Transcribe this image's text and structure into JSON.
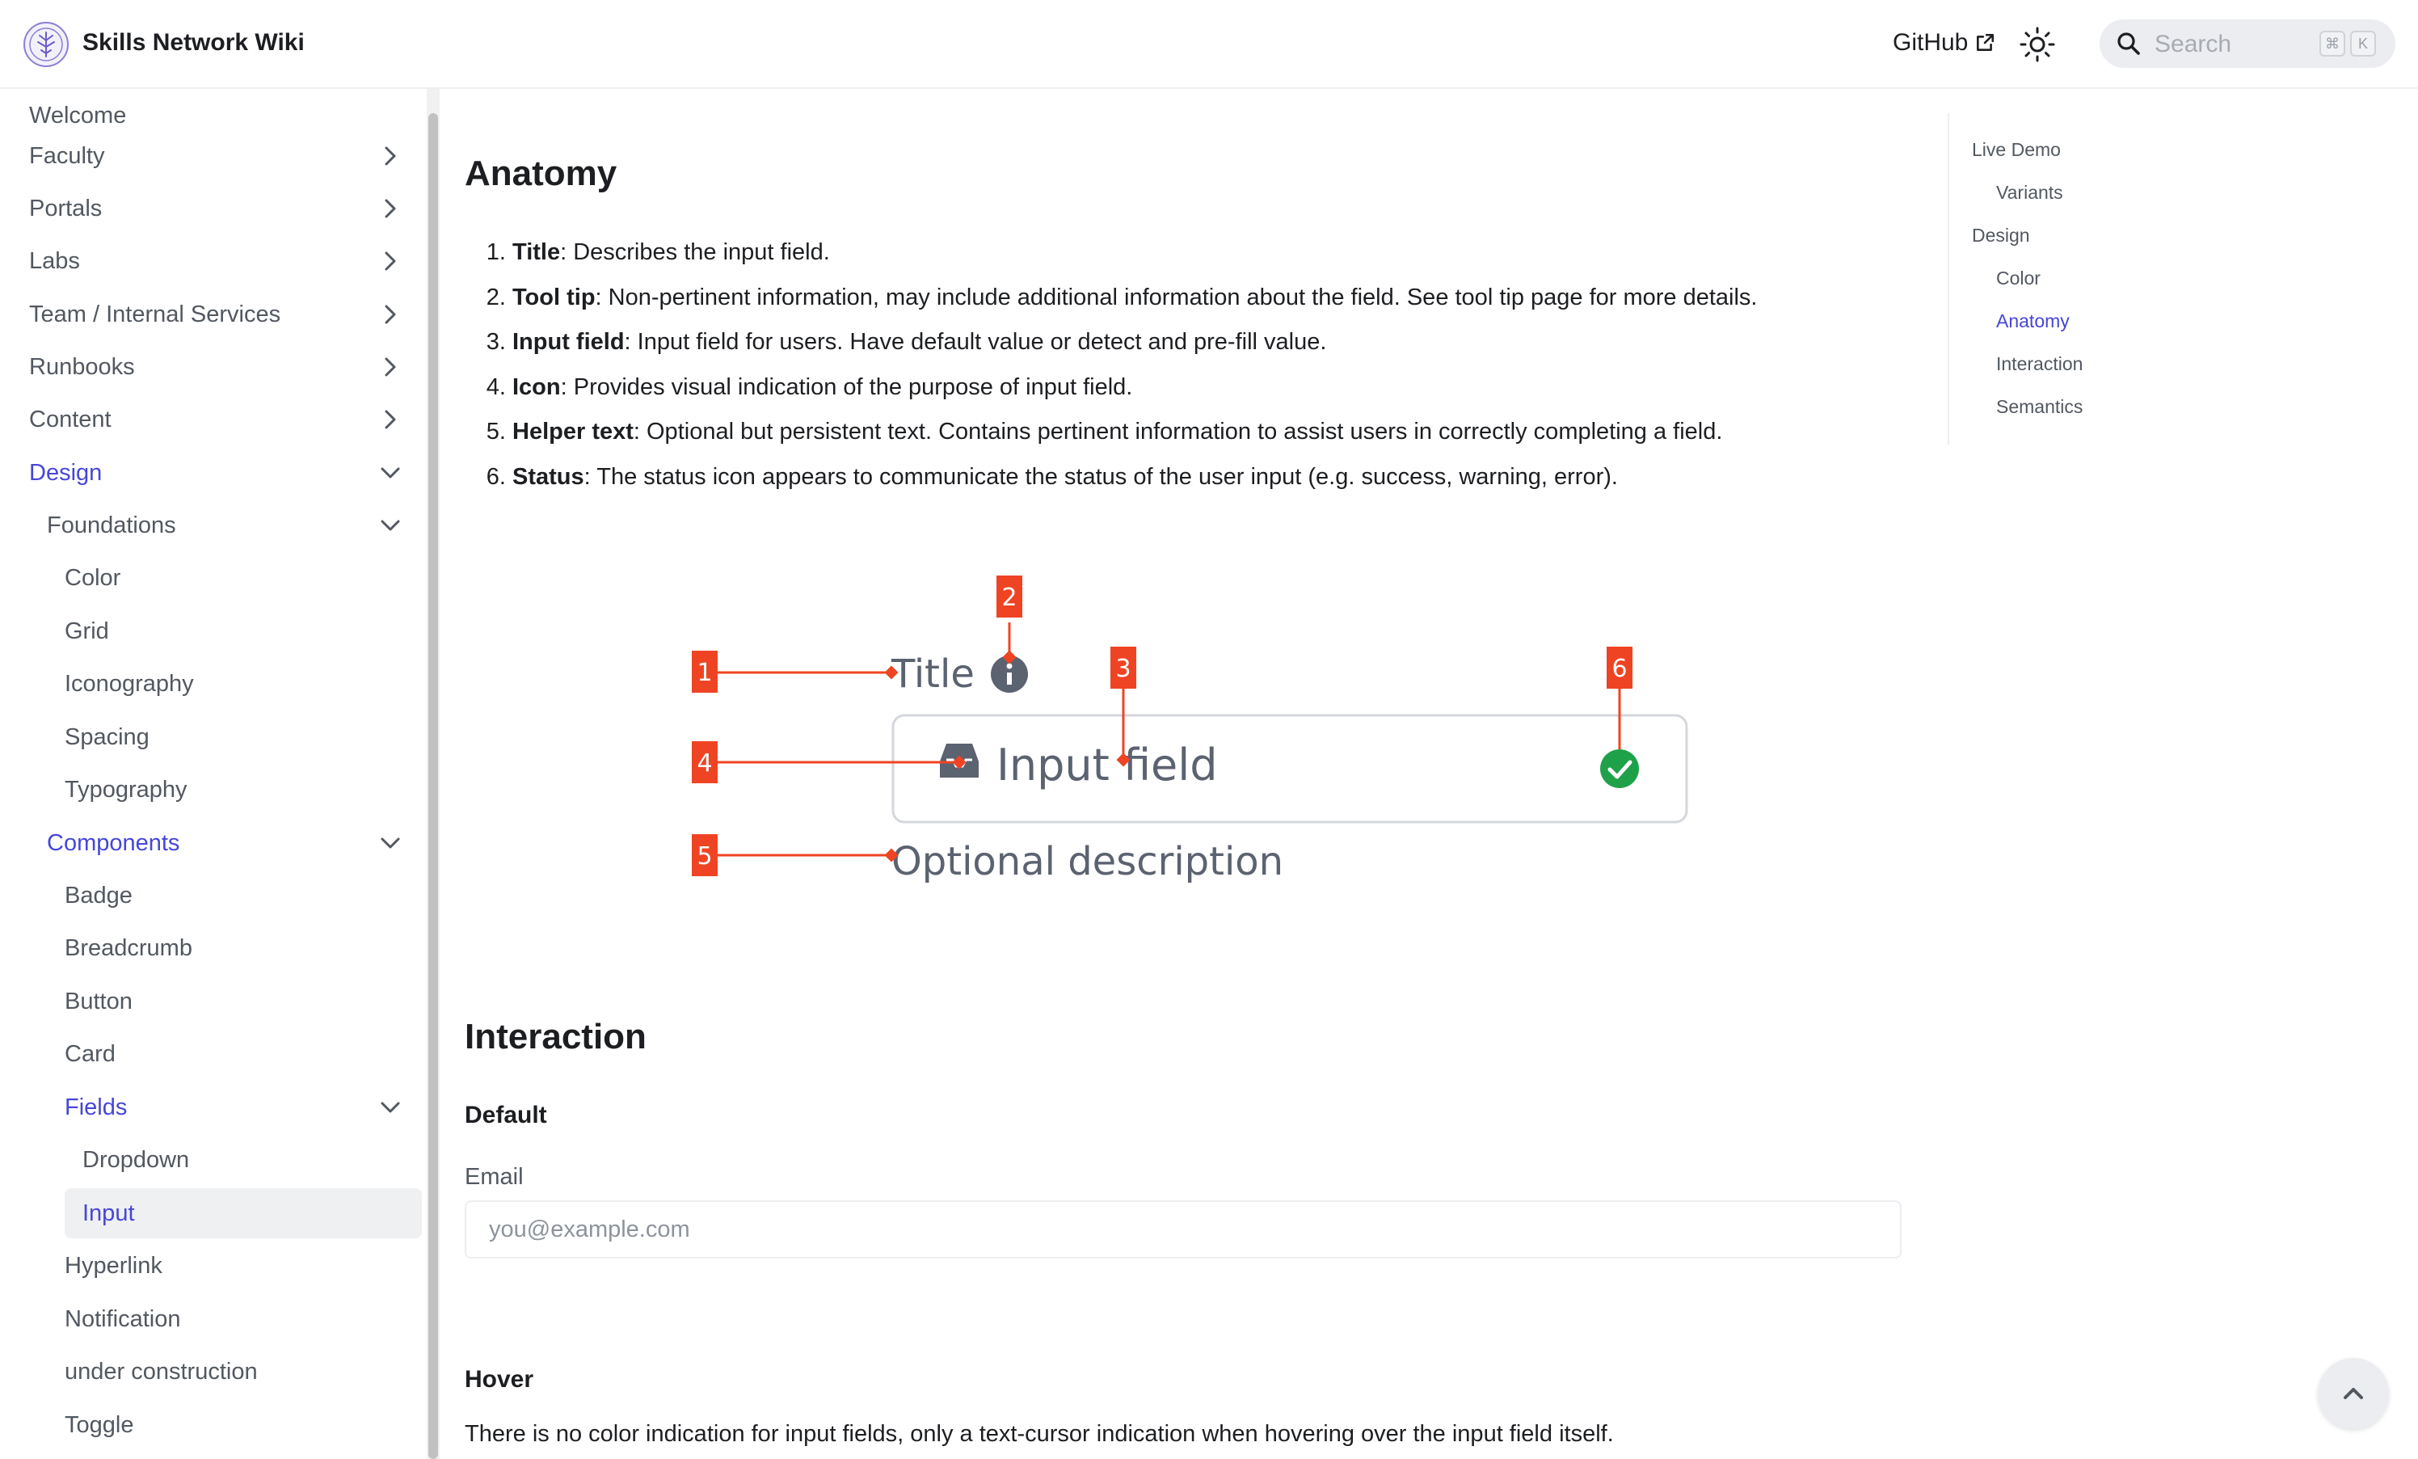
{
  "header": {
    "brand": "Skills Network Wiki",
    "github_label": "GitHub",
    "search_placeholder": "Search",
    "kbd_cmd": "⌘",
    "kbd_k": "K"
  },
  "sidebar": {
    "items": [
      {
        "label": "Welcome"
      },
      {
        "label": "Faculty"
      },
      {
        "label": "Portals"
      },
      {
        "label": "Labs"
      },
      {
        "label": "Team / Internal Services"
      },
      {
        "label": "Runbooks"
      },
      {
        "label": "Content"
      },
      {
        "label": "Design"
      },
      {
        "label": "Foundations"
      },
      {
        "label": "Color"
      },
      {
        "label": "Grid"
      },
      {
        "label": "Iconography"
      },
      {
        "label": "Spacing"
      },
      {
        "label": "Typography"
      },
      {
        "label": "Components"
      },
      {
        "label": "Badge"
      },
      {
        "label": "Breadcrumb"
      },
      {
        "label": "Button"
      },
      {
        "label": "Card"
      },
      {
        "label": "Fields"
      },
      {
        "label": "Dropdown"
      },
      {
        "label": "Input"
      },
      {
        "label": "Hyperlink"
      },
      {
        "label": "Notification"
      },
      {
        "label": "under construction"
      },
      {
        "label": "Toggle"
      }
    ]
  },
  "main": {
    "anatomy_heading": "Anatomy",
    "anatomy_list": [
      {
        "term": "Title",
        "desc": ": Describes the input field."
      },
      {
        "term": "Tool tip",
        "desc": ": Non-pertinent information, may include additional information about the field. See tool tip page for more details."
      },
      {
        "term": "Input field",
        "desc": ": Input field for users. Have default value or detect and pre-fill value."
      },
      {
        "term": "Icon",
        "desc": ": Provides visual indication of the purpose of input field."
      },
      {
        "term": "Helper text",
        "desc": ": Optional but persistent text. Contains pertinent information to assist users in correctly completing a field."
      },
      {
        "term": "Status",
        "desc": ": The status icon appears to communicate the status of the user input (e.g. success, warning, error)."
      }
    ],
    "diagram": {
      "title_text": "Title",
      "input_text": "Input field",
      "description_text": "Optional description",
      "markers": [
        "1",
        "2",
        "3",
        "4",
        "5",
        "6"
      ],
      "marker_color": "#ef4423"
    },
    "interaction_heading": "Interaction",
    "default_heading": "Default",
    "email_label": "Email",
    "email_placeholder": "you@example.com",
    "hover_heading": "Hover",
    "hover_text": "There is no color indication for input fields, only a text-cursor indication when hovering over the input field itself."
  },
  "toc": {
    "items": [
      {
        "label": "Live Demo"
      },
      {
        "label": "Variants"
      },
      {
        "label": "Design"
      },
      {
        "label": "Color"
      },
      {
        "label": "Anatomy"
      },
      {
        "label": "Interaction"
      },
      {
        "label": "Semantics"
      }
    ]
  },
  "colors": {
    "accent": "#4646d8",
    "marker": "#ef4423",
    "success": "#1fa14a"
  }
}
